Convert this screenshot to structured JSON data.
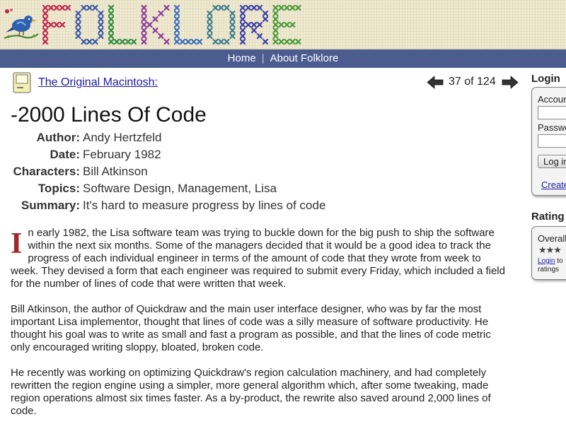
{
  "banner": {
    "logo_text": "FOLKLORE",
    "letter_colors": [
      "#c0264a",
      "#3a57a8",
      "#2e8b3f",
      "#8a3a9c",
      "#3b6dbf",
      "#3a7d8c",
      "#3a3fa8",
      "#4a9a3a"
    ],
    "bird_icon": "bluebird-icon"
  },
  "nav": {
    "home": "Home",
    "separator": "|",
    "about": "About Folklore"
  },
  "story_nav": {
    "project_icon": "macintosh-icon",
    "project": "The Original Macintosh:",
    "position": "37 of 124"
  },
  "story": {
    "title": "-2000 Lines Of Code",
    "meta": [
      {
        "key": "Author:",
        "value": "Andy Hertzfeld"
      },
      {
        "key": "Date:",
        "value": "February 1982"
      },
      {
        "key": "Characters:",
        "value": "Bill Atkinson"
      },
      {
        "key": "Topics:",
        "value": "Software Design, Management, Lisa"
      },
      {
        "key": "Summary:",
        "value": "It's hard to measure progress by lines of code"
      }
    ],
    "dropcap": "I",
    "paragraphs": [
      "n early 1982, the Lisa software team was trying to buckle down for the big push to ship the software within the next six months. Some of the managers decided that it would be a good idea to track the progress of each individual engineer in terms of the amount of code that they wrote from week to week. They devised a form that each engineer was required to submit every Friday, which included a field for the number of lines of code that were written that week.",
      "Bill Atkinson, the author of Quickdraw and the main user interface designer, who was by far the most important Lisa implementor, thought that lines of code was a silly measure of software productivity. He thought his goal was to write as small and fast a program as possible, and that the lines of code metric only encouraged writing sloppy, bloated, broken code.",
      "He recently was working on optimizing Quickdraw's region calculation machinery, and had completely rewritten the region engine using a simpler, more general algorithm which, after some tweaking, made region operations almost six times faster. As a by-product, the rewrite also saved around 2,000 lines of code."
    ]
  },
  "sidebar": {
    "login": {
      "heading": "Login",
      "account_label": "Accoun",
      "password_label": "Passwo",
      "button": "Log in",
      "create_link": "Create"
    },
    "rating": {
      "heading": "Rating",
      "overall_label": "Overall",
      "stars": "★★★",
      "login_link": "Login",
      "login_suffix": " to",
      "ratings_text": "ratings"
    }
  }
}
